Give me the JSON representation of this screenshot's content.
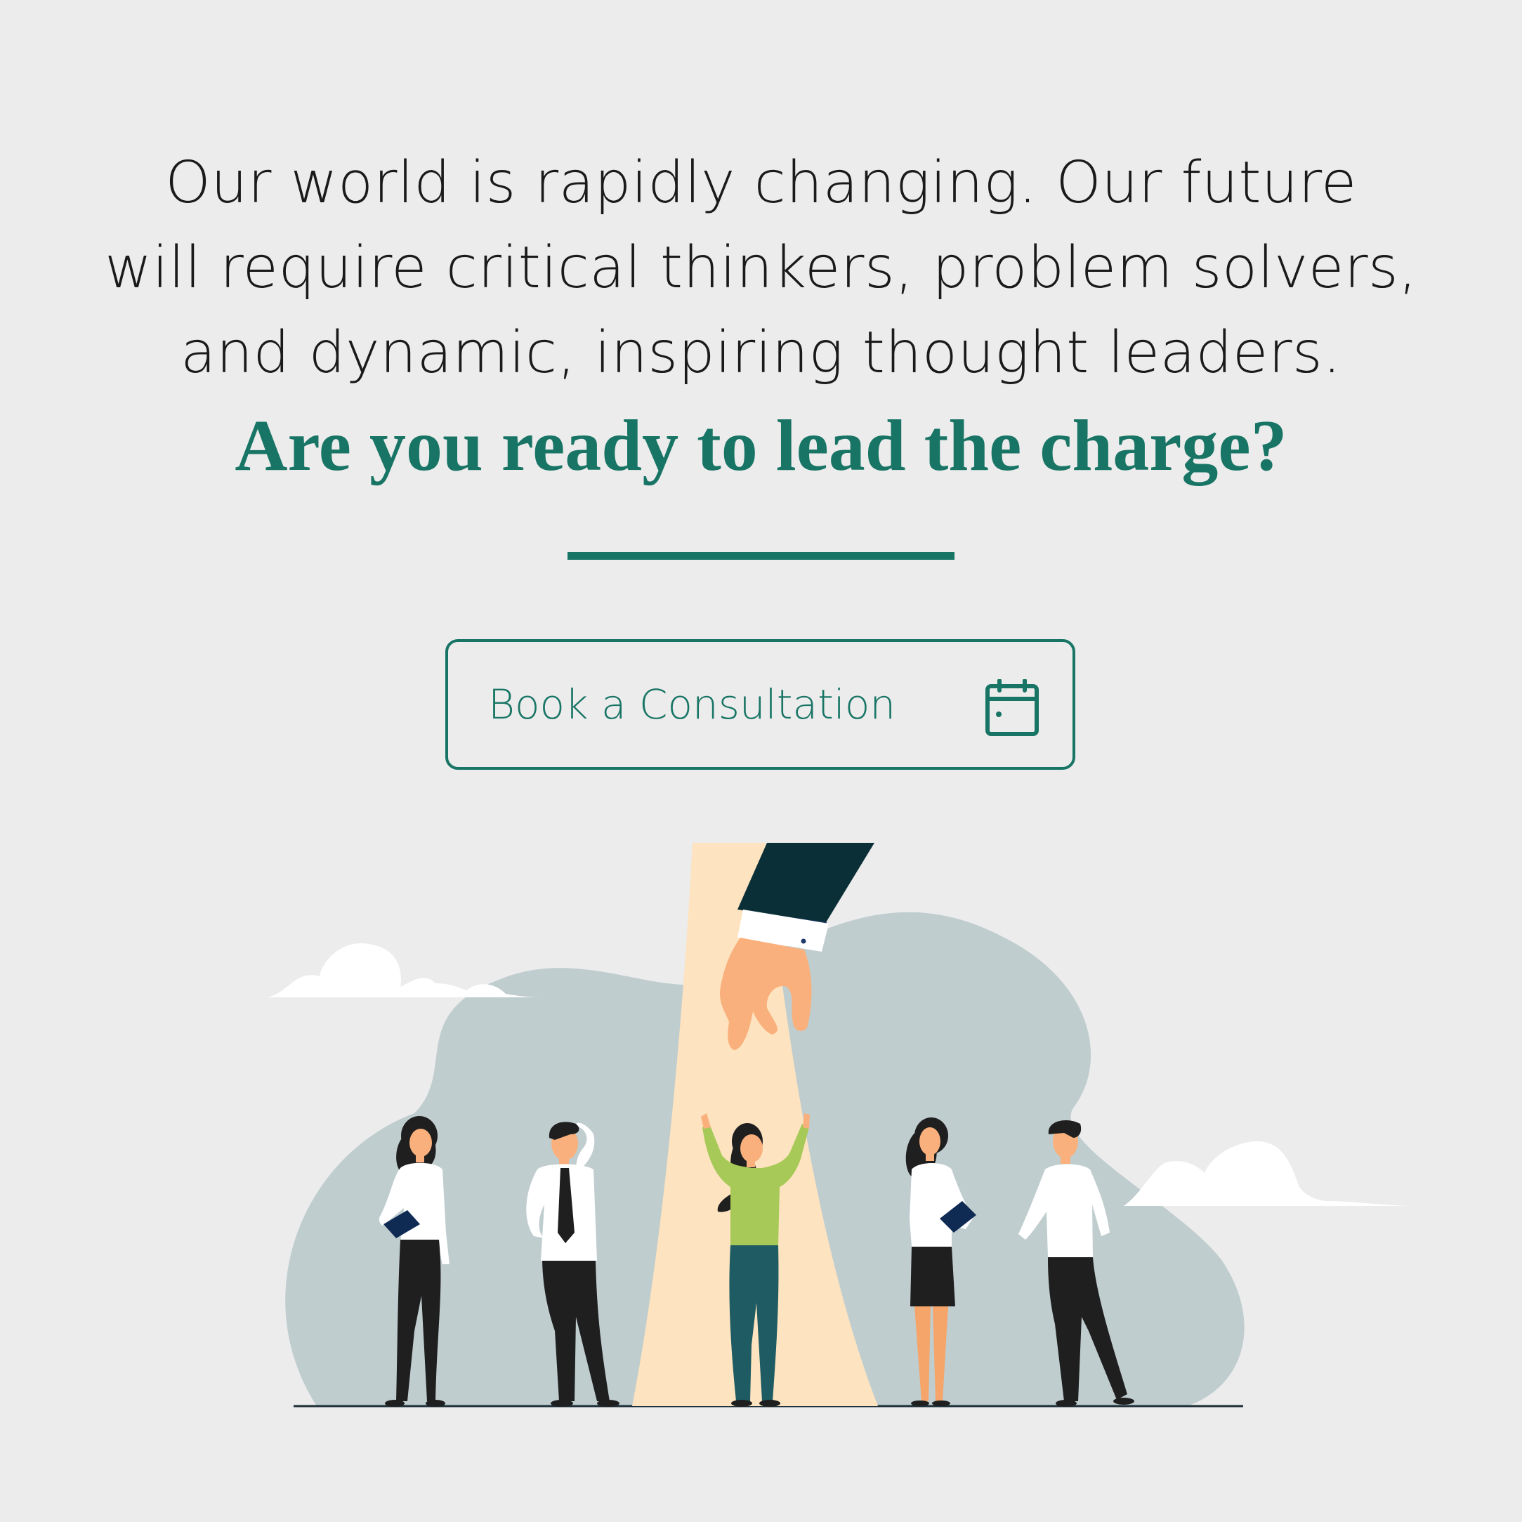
{
  "intro": {
    "lines": [
      "Our world is rapidly changing. Our future",
      "will require critical thinkers, problem solvers,",
      "and dynamic, inspiring thought leaders."
    ]
  },
  "headline": "Are you ready to lead the charge?",
  "cta": {
    "label": "Book a Consultation",
    "icon": "calendar-icon"
  },
  "illustration": {
    "subject": "hand-reaching-down-to-selected-person",
    "icon_names": [
      "cloud-icon",
      "hand-icon",
      "person-icon"
    ]
  },
  "colors": {
    "background": "#ececec",
    "accent": "#187565",
    "text": "#1a1a1a",
    "blob": "#c0cdcf",
    "spotlight": "#fde3bf",
    "shirt_green": "#a7c957",
    "skin": "#f9b07c",
    "dark_suit": "#0b2f37",
    "pants": "#1f1f1f"
  }
}
